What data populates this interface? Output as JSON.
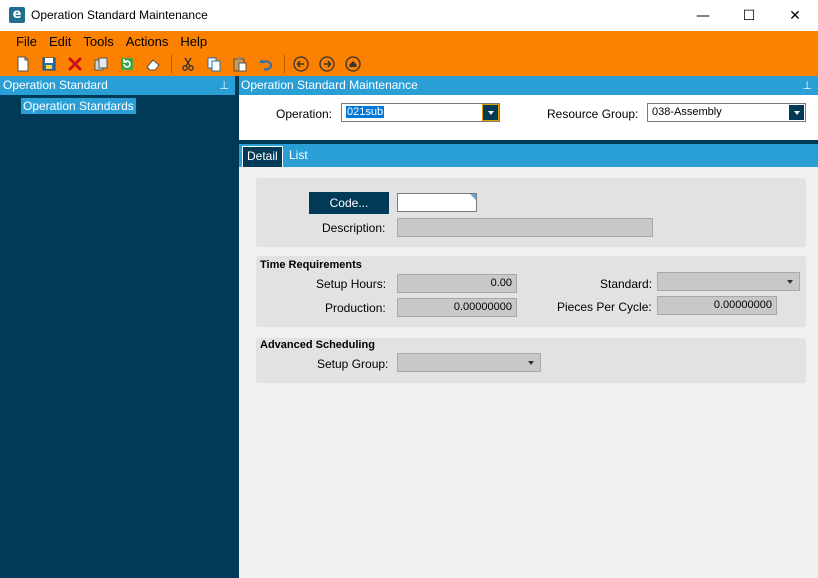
{
  "window": {
    "title": "Operation Standard Maintenance",
    "app_icon_letter": "e",
    "controls": {
      "minimize": "—",
      "maximize": "☐",
      "close": "✕"
    }
  },
  "menu": [
    "File",
    "Edit",
    "Tools",
    "Actions",
    "Help"
  ],
  "toolbar": {
    "icons": [
      "new-icon",
      "save-icon",
      "delete-icon",
      "attachment-icon",
      "refresh-icon",
      "clear-icon",
      "cut-icon",
      "copy-icon",
      "paste-icon",
      "undo-icon",
      "back-icon",
      "forward-icon",
      "home-icon"
    ]
  },
  "left_pane": {
    "title": "Operation Standard",
    "pin": "⊥",
    "tree_items": [
      "Operation Standards"
    ]
  },
  "right_pane": {
    "title": "Operation Standard Maintenance",
    "pin": "⊥",
    "operation_label": "Operation:",
    "operation_value": "021sub",
    "resource_group_label": "Resource Group:",
    "resource_group_value": "038-Assembly"
  },
  "tabs": {
    "detail": "Detail",
    "list": "List"
  },
  "general": {
    "code_button": "Code...",
    "code_value": "",
    "description_label": "Description:",
    "description_value": ""
  },
  "time_requirements": {
    "title": "Time Requirements",
    "setup_hours_label": "Setup Hours:",
    "setup_hours_value": "0.00",
    "standard_label": "Standard:",
    "standard_value": "",
    "production_label": "Production:",
    "production_value": "0.00000000",
    "pieces_per_cycle_label": "Pieces Per Cycle:",
    "pieces_per_cycle_value": "0.00000000"
  },
  "advanced_scheduling": {
    "title": "Advanced Scheduling",
    "setup_group_label": "Setup Group:",
    "setup_group_value": ""
  },
  "colors": {
    "accent_orange": "#fc8100",
    "header_blue": "#2a9fd6",
    "navy": "#003a57"
  }
}
